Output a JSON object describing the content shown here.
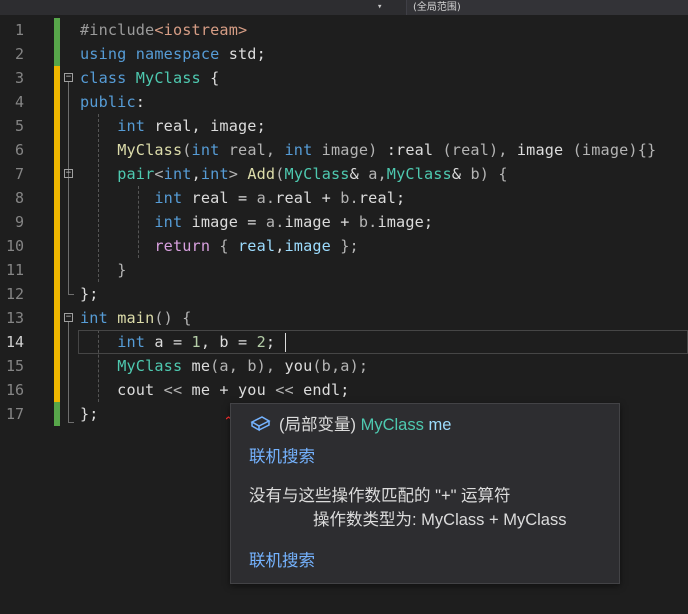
{
  "nav": {
    "dropdown_arrow": "▾",
    "scope_label": "(全局范围)"
  },
  "lines": [
    {
      "n": "1",
      "t": [
        {
          "c": "pp",
          "s": "#include"
        },
        {
          "c": "inc",
          "s": "<iostream>"
        }
      ]
    },
    {
      "n": "2",
      "t": [
        {
          "c": "kw",
          "s": "using"
        },
        {
          "c": "",
          "s": " "
        },
        {
          "c": "kw",
          "s": "namespace"
        },
        {
          "c": "",
          "s": " std;"
        }
      ]
    },
    {
      "n": "3",
      "t": [
        {
          "c": "kw",
          "s": "class"
        },
        {
          "c": "",
          "s": " "
        },
        {
          "c": "ty",
          "s": "MyClass"
        },
        {
          "c": "",
          "s": " {"
        }
      ]
    },
    {
      "n": "4",
      "t": [
        {
          "c": "kw",
          "s": "public"
        },
        {
          "c": "",
          "s": ":"
        }
      ]
    },
    {
      "n": "5",
      "t": [
        {
          "c": "",
          "s": "    "
        },
        {
          "c": "kw",
          "s": "int"
        },
        {
          "c": "",
          "s": " real, image;"
        }
      ]
    },
    {
      "n": "6",
      "t": [
        {
          "c": "",
          "s": "    "
        },
        {
          "c": "fn",
          "s": "MyClass"
        },
        {
          "c": "op",
          "s": "("
        },
        {
          "c": "kw",
          "s": "int"
        },
        {
          "c": "dim",
          "s": " real, "
        },
        {
          "c": "kw",
          "s": "int"
        },
        {
          "c": "dim",
          "s": " image) "
        },
        {
          "c": "",
          "s": ":real "
        },
        {
          "c": "dim",
          "s": "(real), "
        },
        {
          "c": "",
          "s": "image "
        },
        {
          "c": "dim",
          "s": "(image){}"
        }
      ]
    },
    {
      "n": "7",
      "t": [
        {
          "c": "",
          "s": "    "
        },
        {
          "c": "ty",
          "s": "pair"
        },
        {
          "c": "op",
          "s": "<"
        },
        {
          "c": "kw",
          "s": "int"
        },
        {
          "c": "",
          "s": ","
        },
        {
          "c": "kw",
          "s": "int"
        },
        {
          "c": "op",
          "s": ">"
        },
        {
          "c": "",
          "s": " "
        },
        {
          "c": "fn",
          "s": "Add"
        },
        {
          "c": "op",
          "s": "("
        },
        {
          "c": "ty",
          "s": "MyClass"
        },
        {
          "c": "",
          "s": "& "
        },
        {
          "c": "dim",
          "s": "a,"
        },
        {
          "c": "ty",
          "s": "MyClass"
        },
        {
          "c": "",
          "s": "& "
        },
        {
          "c": "dim",
          "s": "b) {"
        }
      ]
    },
    {
      "n": "8",
      "t": [
        {
          "c": "",
          "s": "        "
        },
        {
          "c": "kw",
          "s": "int"
        },
        {
          "c": "",
          "s": " real = "
        },
        {
          "c": "dim",
          "s": "a."
        },
        {
          "c": "",
          "s": "real + "
        },
        {
          "c": "dim",
          "s": "b."
        },
        {
          "c": "",
          "s": "real;"
        }
      ]
    },
    {
      "n": "9",
      "t": [
        {
          "c": "",
          "s": "        "
        },
        {
          "c": "kw",
          "s": "int"
        },
        {
          "c": "",
          "s": " image = "
        },
        {
          "c": "dim",
          "s": "a."
        },
        {
          "c": "",
          "s": "image + "
        },
        {
          "c": "dim",
          "s": "b."
        },
        {
          "c": "",
          "s": "image;"
        }
      ]
    },
    {
      "n": "10",
      "t": [
        {
          "c": "",
          "s": "        "
        },
        {
          "c": "ctl",
          "s": "return"
        },
        {
          "c": "",
          "s": " "
        },
        {
          "c": "dim",
          "s": "{ "
        },
        {
          "c": "var",
          "s": "real"
        },
        {
          "c": "",
          "s": ","
        },
        {
          "c": "var",
          "s": "image"
        },
        {
          "c": "dim",
          "s": " };"
        }
      ]
    },
    {
      "n": "11",
      "t": [
        {
          "c": "",
          "s": "    "
        },
        {
          "c": "dim",
          "s": "}"
        }
      ]
    },
    {
      "n": "12",
      "t": [
        {
          "c": "",
          "s": "};"
        }
      ]
    },
    {
      "n": "13",
      "t": [
        {
          "c": "kw",
          "s": "int"
        },
        {
          "c": "",
          "s": " "
        },
        {
          "c": "fn",
          "s": "main"
        },
        {
          "c": "dim",
          "s": "() {"
        }
      ]
    },
    {
      "n": "14",
      "t": [
        {
          "c": "",
          "s": "    "
        },
        {
          "c": "kw",
          "s": "int"
        },
        {
          "c": "",
          "s": " a = "
        },
        {
          "c": "num",
          "s": "1"
        },
        {
          "c": "",
          "s": ", b = "
        },
        {
          "c": "num",
          "s": "2"
        },
        {
          "c": "",
          "s": ";"
        }
      ]
    },
    {
      "n": "15",
      "t": [
        {
          "c": "",
          "s": "    "
        },
        {
          "c": "ty",
          "s": "MyClass"
        },
        {
          "c": "",
          "s": " me"
        },
        {
          "c": "dim",
          "s": "(a, b), "
        },
        {
          "c": "",
          "s": "you"
        },
        {
          "c": "dim",
          "s": "(b,a);"
        }
      ]
    },
    {
      "n": "16",
      "t": [
        {
          "c": "",
          "s": "    cout "
        },
        {
          "c": "op",
          "s": "<<"
        },
        {
          "c": "",
          "s": " me + you "
        },
        {
          "c": "op",
          "s": "<<"
        },
        {
          "c": "",
          "s": " endl;"
        }
      ]
    },
    {
      "n": "17",
      "t": [
        {
          "c": "",
          "s": "};"
        }
      ]
    }
  ],
  "tooltip": {
    "kind": "(局部变量)",
    "type": "MyClass",
    "name": "me",
    "search_link_1": "联机搜索",
    "error_line_1": "没有与这些操作数匹配的 \"+\" 运算符",
    "error_line_2": "操作数类型为:  MyClass + MyClass",
    "search_link_2": "联机搜索"
  },
  "colors": {
    "change_saved": "#57a64a",
    "change_unsaved": "#efb700",
    "squiggle": "#ff3030"
  }
}
